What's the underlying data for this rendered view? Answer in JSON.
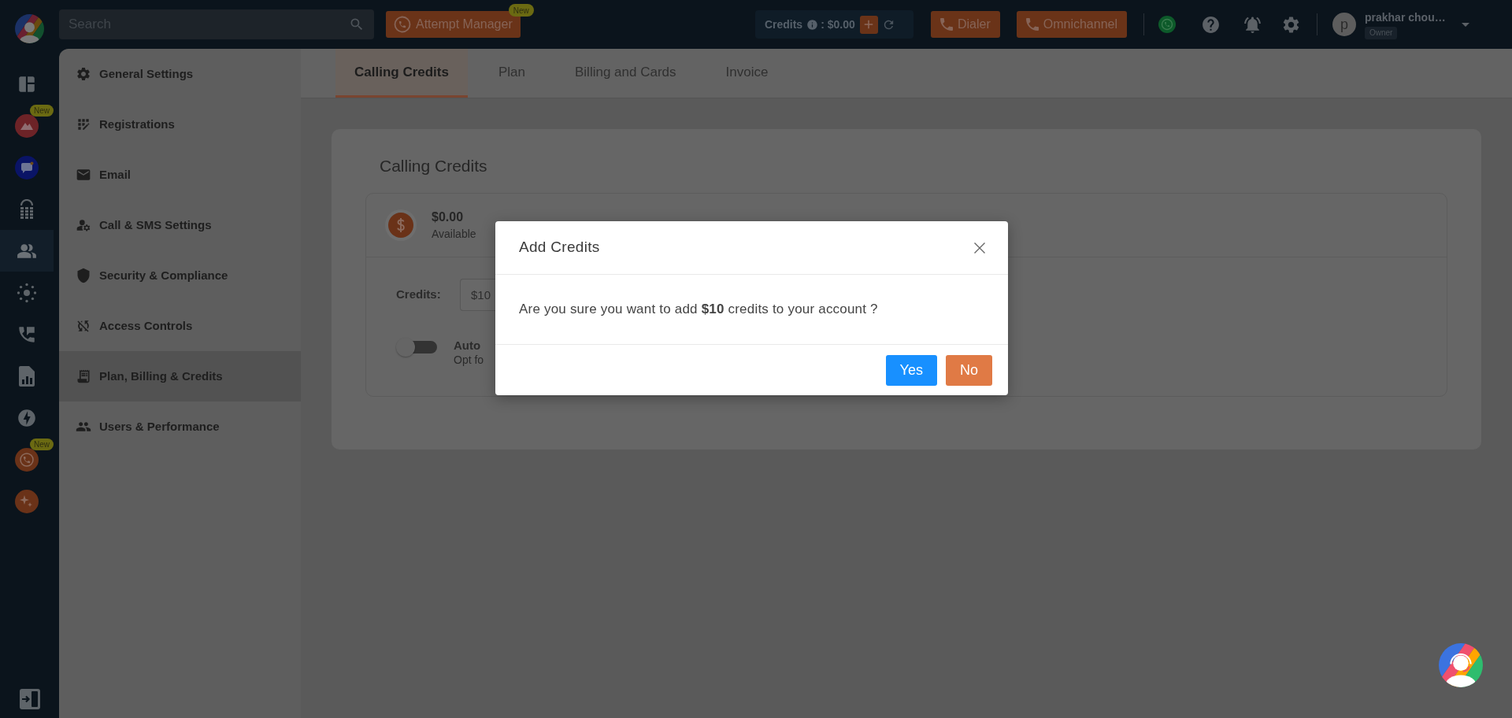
{
  "top_bar": {
    "search": {
      "placeholder": "Search"
    },
    "attempt_manager": {
      "label": "Attempt Manager",
      "badge": "New"
    },
    "credits": {
      "label": "Credits",
      "value": ": $0.00"
    },
    "buttons": [
      {
        "label": "Dialer"
      },
      {
        "label": "Omnichannel"
      }
    ],
    "user": {
      "initial": "p",
      "name": "prakhar chou…",
      "role": "Owner"
    }
  },
  "rail": {
    "items": [
      {
        "selected": false
      },
      {
        "selected": false,
        "badge": "New"
      },
      {
        "selected": false
      },
      {
        "selected": false
      },
      {
        "selected": true
      },
      {
        "selected": false
      },
      {
        "selected": false
      },
      {
        "selected": false
      },
      {
        "selected": false
      },
      {
        "selected": false,
        "badge": "New"
      },
      {
        "selected": false
      }
    ]
  },
  "settings_menu": {
    "items": [
      {
        "label": "General Settings",
        "selected": false
      },
      {
        "label": "Registrations",
        "selected": false
      },
      {
        "label": "Email",
        "selected": false
      },
      {
        "label": "Call & SMS Settings",
        "selected": false
      },
      {
        "label": "Security & Compliance",
        "selected": false
      },
      {
        "label": "Access Controls",
        "selected": false
      },
      {
        "label": "Plan, Billing & Credits",
        "selected": true
      },
      {
        "label": "Users & Performance",
        "selected": false
      }
    ]
  },
  "tabs": [
    {
      "label": "Calling Credits",
      "selected": true
    },
    {
      "label": "Plan",
      "selected": false
    },
    {
      "label": "Billing and Cards",
      "selected": false
    },
    {
      "label": "Invoice",
      "selected": false
    }
  ],
  "credits_card": {
    "title": "Calling Credits",
    "balance": {
      "amount": "$0.00",
      "caption": "Available"
    },
    "credits_field": {
      "label": "Credits:",
      "value": "$10"
    },
    "auto_recharge": {
      "on": false,
      "title": "Auto",
      "caption": "Opt fo"
    }
  },
  "dialog": {
    "title": "Add Credits",
    "message": "Are you sure you want to add **$10** credits to your account ?",
    "buttons": [
      {
        "label": "Yes",
        "kind": "confirm"
      },
      {
        "label": "No",
        "kind": "cancel"
      }
    ]
  }
}
